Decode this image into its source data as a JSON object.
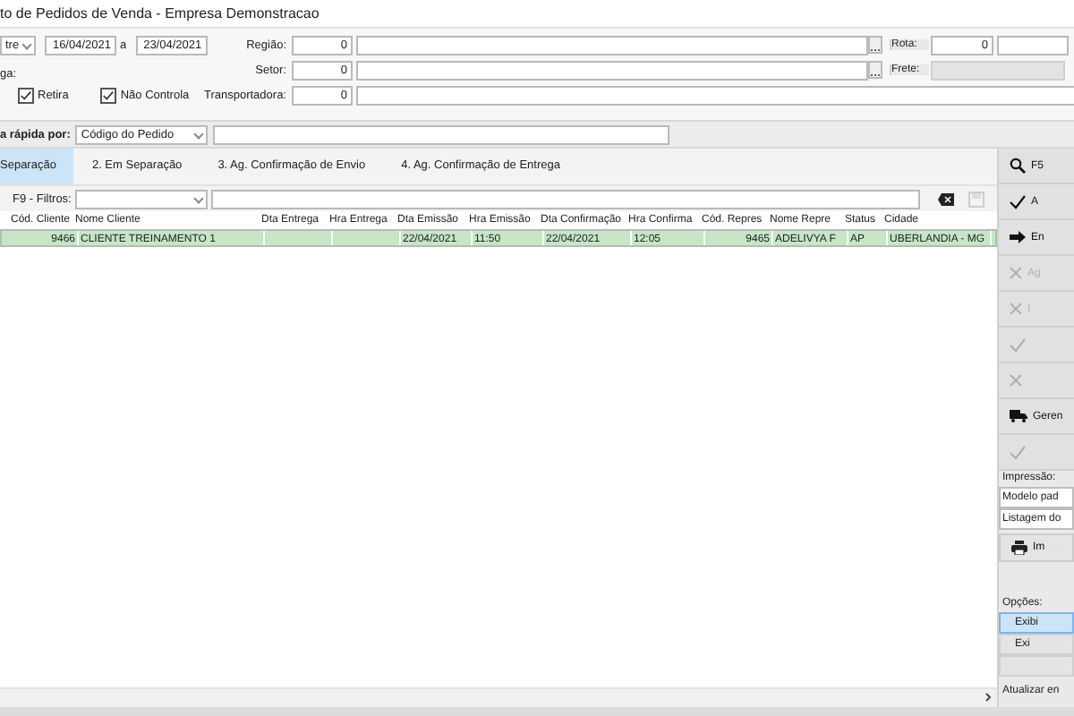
{
  "window": {
    "title": "to de Pedidos de Venda  -  Empresa Demonstracao"
  },
  "filters": {
    "period_select": "tre",
    "date_from": "16/04/2021",
    "date_sep": "a",
    "date_to": "23/04/2021",
    "group_label": "ga:",
    "checkboxes": [
      {
        "label": "Retira",
        "checked": true
      },
      {
        "label": "Não Controla",
        "checked": true
      }
    ],
    "rows": [
      {
        "label": "Região:",
        "code": "0",
        "kind": "lookup",
        "side_label": "Rota:",
        "side_value": "0"
      },
      {
        "label": "Setor:",
        "code": "0",
        "kind": "lookup",
        "side_label": "Frete:"
      },
      {
        "label": "Transportadora:",
        "code": "0",
        "kind": "plain"
      }
    ]
  },
  "quick_search": {
    "label": "a rápida por:",
    "select": "Código do Pedido"
  },
  "tabs": [
    {
      "label": "Separação",
      "selected": true
    },
    {
      "label": "2. Em Separação",
      "selected": false
    },
    {
      "label": "3. Ag. Confirmação de Envio",
      "selected": false
    },
    {
      "label": "4. Ag. Confirmação de Entrega",
      "selected": false
    }
  ],
  "filter_bar": {
    "label": "F9 - Filtros:"
  },
  "table": {
    "columns": [
      "Cód. Cliente",
      "Nome Cliente",
      "Dta Entrega",
      "Hra Entrega",
      "Dta Emissão",
      "Hra Emissão",
      "Dta Confirmação",
      "Hra Confirma",
      "Cód. Repres",
      "Nome Repre",
      "Status",
      "Cidade"
    ],
    "rows": [
      {
        "selected": true,
        "cells": [
          "9466",
          "CLIENTE TREINAMENTO 1",
          "",
          "",
          "22/04/2021",
          "11:50",
          "22/04/2021",
          "12:05",
          "9465",
          "ADELIVYA F",
          "AP",
          "UBERLANDIA - MG"
        ]
      }
    ]
  },
  "side_panel": {
    "buttons": [
      {
        "kind": "search",
        "label": "F5",
        "disabled": false
      },
      {
        "kind": "confirm",
        "label": "A",
        "disabled": false
      },
      {
        "kind": "send",
        "label": "En",
        "disabled": false
      },
      {
        "kind": "cancel",
        "label": "Ag",
        "disabled": true
      },
      {
        "kind": "cancel",
        "label": "I",
        "disabled": true
      },
      {
        "kind": "confirm",
        "disabled": true
      },
      {
        "kind": "cancel",
        "disabled": true
      },
      {
        "kind": "delivery",
        "label": "Geren",
        "disabled": false
      },
      {
        "kind": "confirm",
        "disabled": true
      }
    ],
    "print_label": "Impressão:",
    "print_selects": [
      "Modelo pad",
      "Listagem do"
    ],
    "print_button": "Im",
    "options_label": "Opções:",
    "options": [
      {
        "label": "Exibi",
        "selected": true
      },
      {
        "label": "Exi",
        "selected": false
      },
      {
        "selected": false
      }
    ],
    "refresh_label": "Atualizar en"
  }
}
